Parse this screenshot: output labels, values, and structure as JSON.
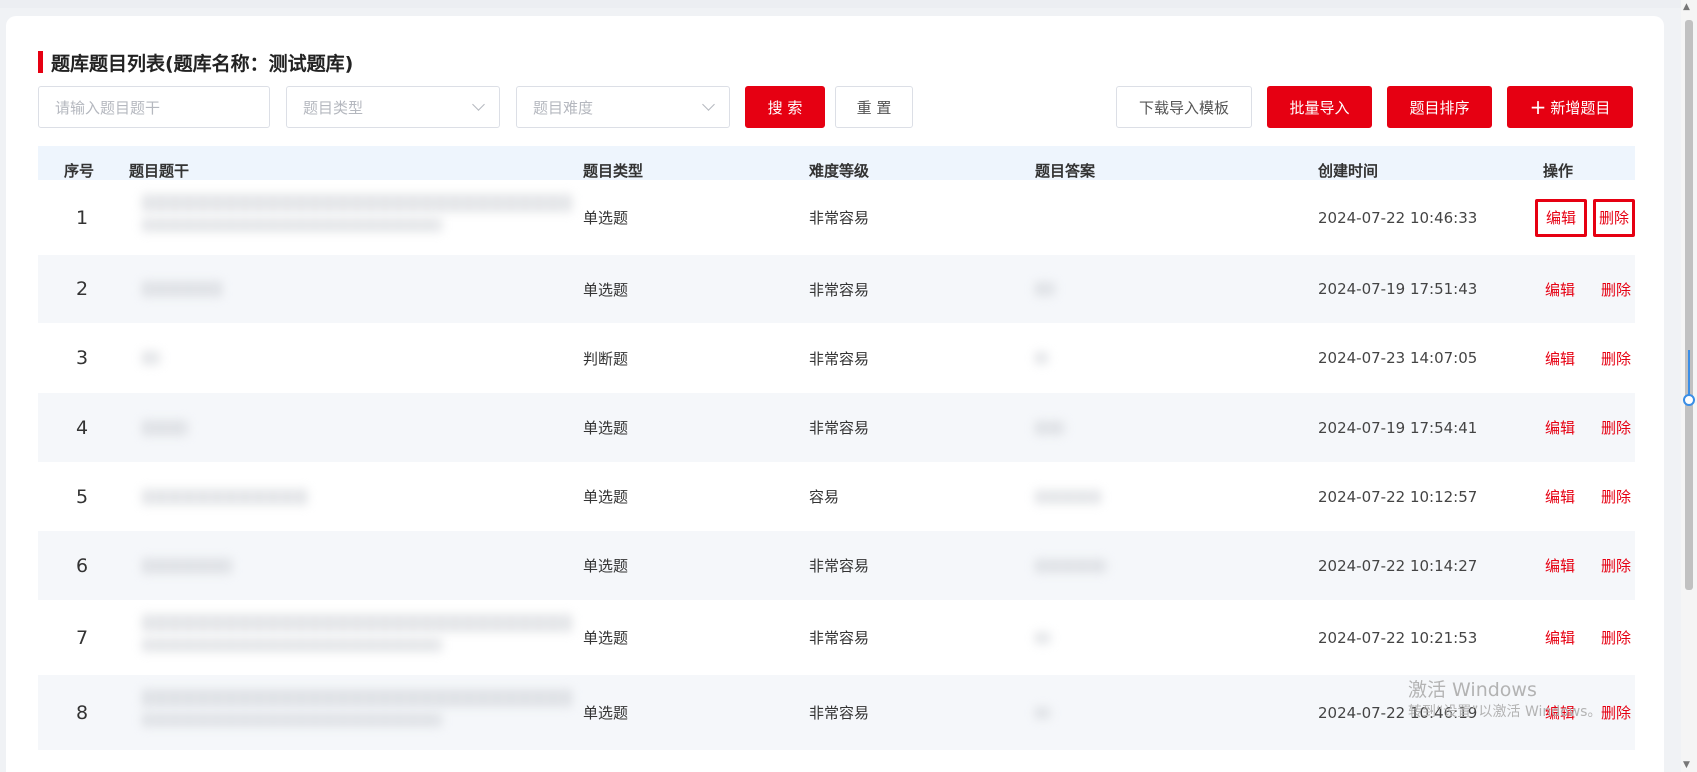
{
  "page": {
    "title": "题库题目列表(题库名称：测试题库)"
  },
  "filters": {
    "stem_placeholder": "请输入题目题干",
    "type_placeholder": "题目类型",
    "difficulty_placeholder": "题目难度",
    "search_label": "搜 索",
    "reset_label": "重 置"
  },
  "toolbar": {
    "download_template_label": "下载导入模板",
    "batch_import_label": "批量导入",
    "sort_label": "题目排序",
    "add_plus": "+",
    "add_label": "新增题目"
  },
  "table": {
    "columns": [
      "序号",
      "题目题干",
      "题目类型",
      "难度等级",
      "题目答案",
      "创建时间",
      "操作"
    ],
    "edit_label": "编辑",
    "delete_label": "删除",
    "rows": [
      {
        "index": "1",
        "type": "单选题",
        "difficulty": "非常容易",
        "created": "2024-07-22 10:46:33"
      },
      {
        "index": "2",
        "type": "单选题",
        "difficulty": "非常容易",
        "created": "2024-07-19 17:51:43"
      },
      {
        "index": "3",
        "type": "判断题",
        "difficulty": "非常容易",
        "created": "2024-07-23 14:07:05"
      },
      {
        "index": "4",
        "type": "单选题",
        "difficulty": "非常容易",
        "created": "2024-07-19 17:54:41"
      },
      {
        "index": "5",
        "type": "单选题",
        "difficulty": "容易",
        "created": "2024-07-22 10:12:57"
      },
      {
        "index": "6",
        "type": "单选题",
        "difficulty": "非常容易",
        "created": "2024-07-22 10:14:27"
      },
      {
        "index": "7",
        "type": "单选题",
        "difficulty": "非常容易",
        "created": "2024-07-22 10:21:53"
      },
      {
        "index": "8",
        "type": "单选题",
        "difficulty": "非常容易",
        "created": "2024-07-22 10:46:19"
      }
    ]
  },
  "watermark": {
    "line1": "激活 Windows",
    "line2": "转到“设置”以激活 Windows。"
  },
  "colors": {
    "accent": "#e60012",
    "header_bg": "#eef5fd",
    "row_alt_bg": "#f5f7fa"
  }
}
